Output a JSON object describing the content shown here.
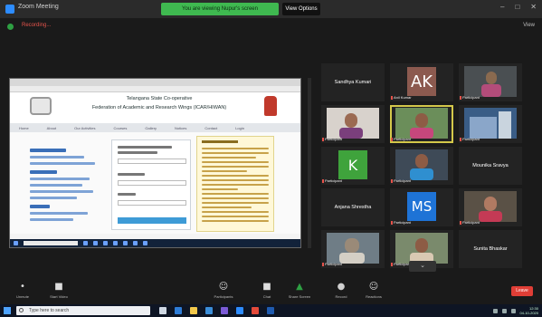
{
  "window": {
    "title": "Zoom Meeting",
    "share_banner": "You are viewing Nupur's screen",
    "stop_share": "View Options",
    "controls": [
      "–",
      "□",
      "✕"
    ]
  },
  "statusbar": {
    "recording": "Recording...",
    "view": "View"
  },
  "shared_screen": {
    "site_title": "Telangana State Co-operative",
    "site_subtitle": "Federation of Academic and Research Wings (ICAR/HIWAN)",
    "nav": [
      "Home",
      "About",
      "Our Activities",
      "Courses",
      "Gallery",
      "Notices",
      "Contact",
      "Login"
    ]
  },
  "gallery": {
    "tiles": [
      {
        "name": "Sandhya Kumari",
        "kind": "name"
      },
      {
        "name": "Anil Kumar",
        "kind": "avatar",
        "initials": "AK"
      },
      {
        "name": "Participant",
        "kind": "video"
      },
      {
        "name": "Participant",
        "kind": "video"
      },
      {
        "name": "Participant",
        "kind": "video",
        "active": true
      },
      {
        "name": "Participant",
        "kind": "video"
      },
      {
        "name": "Participant",
        "kind": "avatar",
        "initials": "K"
      },
      {
        "name": "Participant",
        "kind": "video"
      },
      {
        "name": "Mounika Sravya",
        "kind": "name"
      },
      {
        "name": "Anjana Shrestha",
        "kind": "name"
      },
      {
        "name": "Participant",
        "kind": "avatar",
        "initials": "MS"
      },
      {
        "name": "Participant",
        "kind": "video"
      },
      {
        "name": "Participant",
        "kind": "video"
      },
      {
        "name": "Participant",
        "kind": "video"
      },
      {
        "name": "Sunita Bhaskar",
        "kind": "name"
      }
    ],
    "nav": "⌄"
  },
  "controls": {
    "unmute": "Unmute",
    "stop_video": "Start Video",
    "participants": "Participants",
    "participants_count": "25",
    "chat": "Chat",
    "share_screen": "Share Screen",
    "record": "Record",
    "reactions": "Reactions",
    "leave": "Leave"
  },
  "taskbar": {
    "search_placeholder": "Type here to search",
    "time": "12:30",
    "date": "04-10-2020"
  },
  "colors": {
    "zoom_blue": "#2d8cff",
    "share_green": "#3fb950",
    "leave_red": "#e03e36",
    "active_speaker": "#d4c84a"
  }
}
